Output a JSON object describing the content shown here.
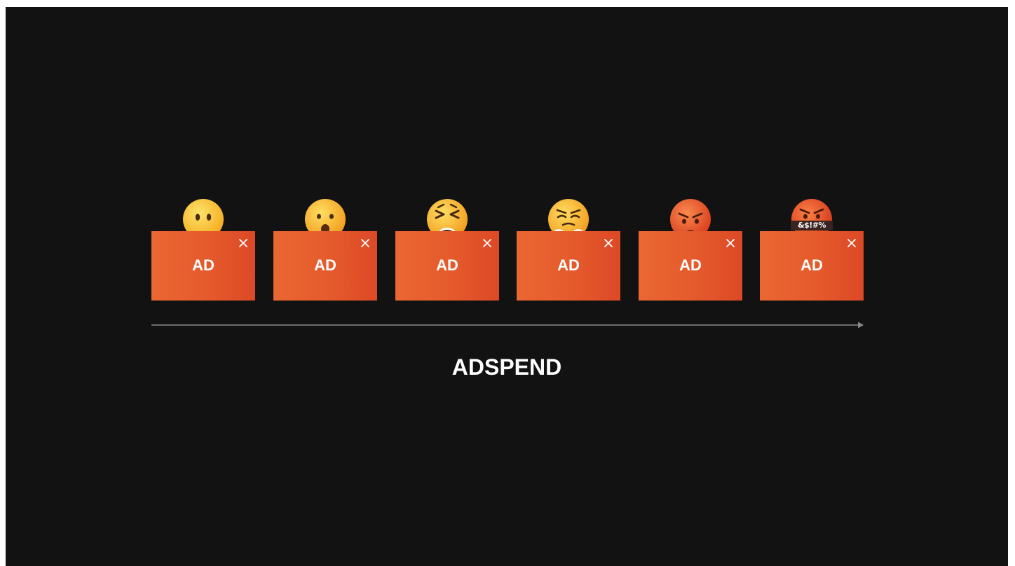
{
  "ads": [
    {
      "label": "AD",
      "emoji": "neutral-face-icon"
    },
    {
      "label": "AD",
      "emoji": "hushed-face-icon"
    },
    {
      "label": "AD",
      "emoji": "tired-face-icon"
    },
    {
      "label": "AD",
      "emoji": "face-with-steam-icon"
    },
    {
      "label": "AD",
      "emoji": "pouting-face-icon"
    },
    {
      "label": "AD",
      "emoji": "face-with-symbols-icon",
      "symbols": "&$!#%"
    }
  ],
  "axis": {
    "label": "ADSPEND"
  },
  "colors": {
    "background": "#121212",
    "ad_gradient_start": "#ea6732",
    "ad_gradient_end": "#dd4926",
    "axis_line": "#8a8a8a",
    "text": "#ffffff"
  }
}
